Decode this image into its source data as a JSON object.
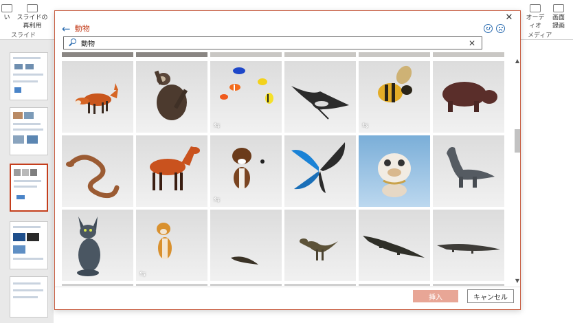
{
  "ribbon": {
    "slide_reuse_label_1": "スライドの",
    "slide_reuse_label_2": "再利用",
    "slide_group_label": "スライド",
    "audio_label": "オーディオ",
    "screen_record_label_1": "画面",
    "screen_record_label_2": "録画",
    "media_group_label": "メディア"
  },
  "dialog": {
    "title": "動物",
    "search": {
      "value": "動物",
      "placeholder": ""
    },
    "close_icon": "close-icon",
    "insert_label": "挿入",
    "cancel_label": "キャンセル",
    "colors": {
      "accent": "#c43e1c",
      "link_blue": "#2b6cb0",
      "insert_disabled": "#e8a696"
    }
  },
  "models": [
    {
      "name": "fox",
      "animated": false
    },
    {
      "name": "sloth",
      "animated": false
    },
    {
      "name": "tropical-fish",
      "animated": true
    },
    {
      "name": "manta-ray",
      "animated": false
    },
    {
      "name": "bee",
      "animated": true
    },
    {
      "name": "hippo",
      "animated": false
    },
    {
      "name": "snake",
      "animated": false
    },
    {
      "name": "horse",
      "animated": false
    },
    {
      "name": "dog-boxer",
      "animated": true
    },
    {
      "name": "butterfly",
      "animated": false
    },
    {
      "name": "bulldog-cartoon",
      "animated": false
    },
    {
      "name": "dinosaur",
      "animated": false
    },
    {
      "name": "sphynx-cat",
      "animated": false
    },
    {
      "name": "shiba-inu",
      "animated": true
    },
    {
      "name": "small-crocodile",
      "animated": false
    },
    {
      "name": "raptor",
      "animated": false
    },
    {
      "name": "crocodile",
      "animated": false
    },
    {
      "name": "komodo-lizard",
      "animated": false
    }
  ],
  "anim_badge_glyph": "⇆"
}
